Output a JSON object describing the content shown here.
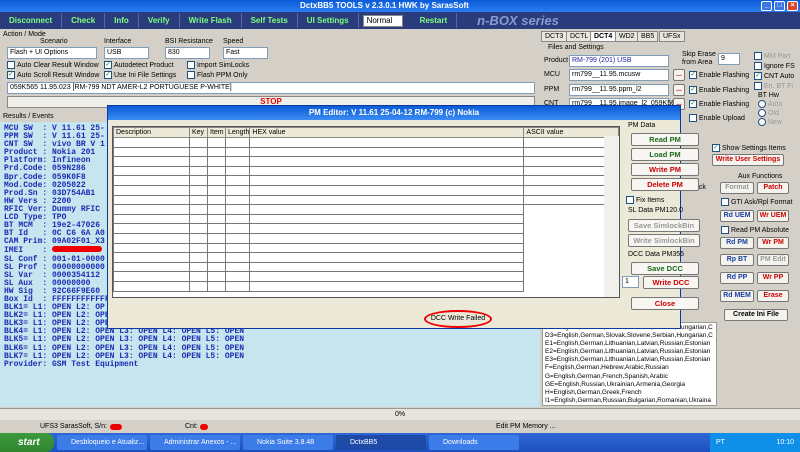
{
  "window": {
    "title": "DctxBB5 TOOLS v 2.3.0.1 HWK by SarasSoft"
  },
  "toolbar": {
    "buttons": [
      "Disconnect",
      "Check",
      "Info",
      "Verify",
      "Write Flash",
      "Self Tests",
      "UI Settings"
    ],
    "mode": "Normal",
    "restart": "Restart",
    "brand": "n-BOX series"
  },
  "action": {
    "group": "Action / Mode",
    "scenario_label": "Scenario",
    "scenario": "Flash + UI Options",
    "interface_label": "Interface",
    "interface": "USB",
    "bsi_label": "BSI Resistance",
    "bsi": "830",
    "speed_label": "Speed",
    "speed": "Fast",
    "checks": [
      "Auto Clear Result Window",
      "Autodetect Product",
      "Import SimLocks",
      "Auto Scroll Result Window",
      "Use Ini File Settings",
      "Flash PPM Only"
    ],
    "product_line": "059K565 11.95.023 [RM-799 NDT AMER-L2 PORTUGUESE P-WHITE]",
    "stop": "STOP"
  },
  "results": {
    "label": "Results / Events",
    "lines": [
      "MCU SW  : V 11.61 25-",
      "PPM SW  : V 11.61 25-",
      "CNT SW  : vivo BR V 1",
      "Product : Nokia 201",
      "Platform: Infineon",
      "Prd.Code: 059N286",
      "Bpr.Code: 059K0F8",
      "Mod.Code: 0205022",
      "Prod.Sn : 03D754AB1",
      "HW Vers : 2200",
      "RFIC Ver: Dummy RFIC",
      "LCD Type: TPO",
      "BT MCM  : 19e2-47026",
      "BT Id   : 0C C6 6A A0",
      "CAM Prim: 09A02F01_X3",
      "IMEI    : ",
      "SL Conf : 001-01-0000",
      "SL Prof : 00000000000",
      "SL Var  : 0000354112",
      "SL Aux  : 00000000",
      "HW Sig  : 92C66F9E60",
      "Box Id  : FFFFFFFFFFFF",
      "BLK1= L1: OPEN L2: OP",
      "BLK2= L1: OPEN L2: OPEN L3: OPEN L4: OPEN L5: OPEN",
      "BLK3= L1: OPEN L2: OPEN L3: OPEN L4: OPEN L5: OPEN",
      "BLK4= L1: OPEN L2: OPEN L3: OPEN L4: OPEN L5: OPEN",
      "BLK5= L1: OPEN L2: OPEN L3: OPEN L4: OPEN L5: OPEN",
      "BLK6= L1: OPEN L2: OPEN L3: OPEN L4: OPEN L5: OPEN",
      "BLK7= L1: OPEN L2: OPEN L3: OPEN L4: OPEN L5: OPEN",
      "Provider: GSM Test Equipment"
    ]
  },
  "right": {
    "tabs": [
      "DCT3",
      "DCTL",
      "DCT4",
      "WD2",
      "BB5",
      "UFSx"
    ],
    "files_label": "Files and Settings",
    "product_label": "Product",
    "product": "RM-799  (201) USB",
    "skip_erase": "Skip Erase from Area",
    "skip_val": "9",
    "mcu_label": "MCU",
    "mcu": "rm799__11.95.mcusw",
    "ppm_label": "PPM",
    "ppm": "rm799__11.95.ppm_l2",
    "cnt_label": "CNT",
    "cnt": "rm799__11.95.image_l2_059K565",
    "enable": "Enable Flashing",
    "enable_upload": "Enable Upload",
    "mm_part": "MM Part",
    "ignore_fs": "Ignore FS",
    "cnt_auto": "CNT Auto",
    "en_bt_fi": "En. BT Fi",
    "bt_hw": "BT Hw",
    "auto": "Auto",
    "old": "Old",
    "new": "New",
    "show_settings": "Show Settings Items",
    "write_user": "Write User Settings",
    "aux": "Aux Functions",
    "format": "Format",
    "patch": "Patch",
    "gti": "GTI Ask/Rpl Format",
    "rd_uem": "Rd UEM",
    "wr_uem": "Wr UEM",
    "read_pm_abs": "Read PM Absolute",
    "rd_pm": "Rd PM",
    "wr_pm": "Wr PM",
    "rp_bt": "Rp BT",
    "pm_edit": "PM Edit",
    "rd_pp": "Rd PP",
    "wr_pp": "Wr PP",
    "rd_mem": "Rd MEM",
    "erase": "Erase",
    "create_ini": "Create Ini File",
    "ems": "ems",
    "ock": "ock",
    "langs": [
      "D2=English,German,Slovak,Slovene,Serbian,Hungarian,C",
      "D3=English,German,Slovak,Slovene,Serbian,Hungarian,C",
      "E1=English,German,Lithuanian,Latvian,Russian,Estonian",
      "E2=English,German,Lithuanian,Latvian,Russian,Estonian",
      "E3=English,German,Lithuanian,Latvian,Russian,Estonian",
      "F=English,German,Hebrew,Arabic,Russian",
      "G=English,German,French,Spanish,Arabic",
      "GE=English,Russian,Ukrainian,Armenia,Georgia",
      "H=English,German,Greek,French",
      "I1=English,German,Russian,Bulgarian,Romanian,Ukraina",
      "I2=English,German,Russian,Bulgarian,Romanian,Ukraina"
    ]
  },
  "dialog": {
    "title": "PM Editor: V 11.61 25-04-12 RM-799 (c) Nokia",
    "cols": [
      "Description",
      "Key",
      "Item",
      "Length",
      "HEX value",
      "ASCII value"
    ],
    "pm_data": "PM Data",
    "read_pm": "Read PM",
    "load_pm": "Load PM",
    "write_pm": "Write PM",
    "delete_pm": "Delete PM",
    "fix_items": "Fix Items",
    "sl_data": "SL Data PM120.0",
    "save_simlock": "Save SimlockBin",
    "write_simlock": "Write SimlockBin",
    "dcc_data": "DCC Data PM355",
    "save_dcc": "Save DCC",
    "write_dcc": "Write DCC",
    "dcc_val": "1",
    "close": "Close",
    "status": "DCC Write Failed"
  },
  "progress": {
    "value": "0%"
  },
  "statusbar": {
    "left": "UFS3 SarasSoft, S/n:",
    "mid": "Cnt:",
    "right": "Edit PM Memory ..."
  },
  "taskbar": {
    "start": "start",
    "items": [
      "Desbloqueio e Atualiz...",
      "Administrar Anexos - ...",
      "Nokia Suite 3.8.48",
      "DctxBB5",
      "Downloads"
    ],
    "lang": "PT",
    "time": "10:10"
  }
}
